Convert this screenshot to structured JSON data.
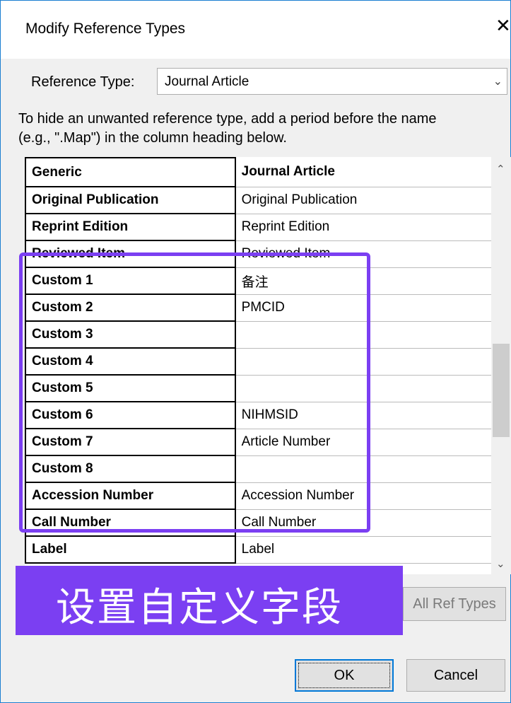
{
  "window": {
    "title": "Modify Reference Types",
    "close_glyph": "✕"
  },
  "reference_type": {
    "label": "Reference Type:",
    "value": "Journal Article"
  },
  "help_text": {
    "line1": "To hide an unwanted reference type, add a period before the name",
    "line2": "(e.g., \".Map\") in the column heading below."
  },
  "grid": {
    "rows": [
      {
        "field": "Generic",
        "value": "Journal Article"
      },
      {
        "field": "Original Publication",
        "value": "Original Publication"
      },
      {
        "field": "Reprint Edition",
        "value": "Reprint Edition"
      },
      {
        "field": "Reviewed Item",
        "value": "Reviewed Item"
      },
      {
        "field": "Custom 1",
        "value": "备注"
      },
      {
        "field": "Custom 2",
        "value": "PMCID"
      },
      {
        "field": "Custom 3",
        "value": ""
      },
      {
        "field": "Custom 4",
        "value": ""
      },
      {
        "field": "Custom 5",
        "value": ""
      },
      {
        "field": "Custom 6",
        "value": "NIHMSID"
      },
      {
        "field": "Custom 7",
        "value": "Article Number"
      },
      {
        "field": "Custom 8",
        "value": ""
      },
      {
        "field": "Accession Number",
        "value": "Accession Number"
      },
      {
        "field": "Call Number",
        "value": "Call Number"
      },
      {
        "field": "Label",
        "value": "Label"
      }
    ]
  },
  "overlay": {
    "banner_text": "设置自定义字段",
    "accent_color": "#7b3ff2"
  },
  "buttons": {
    "all_ref_types": "All Ref Types",
    "ok": "OK",
    "cancel": "Cancel"
  },
  "icons": {
    "dropdown": "chevron-down-icon",
    "scroll_up": "chevron-up-icon",
    "scroll_down": "chevron-down-icon",
    "close": "close-icon"
  }
}
